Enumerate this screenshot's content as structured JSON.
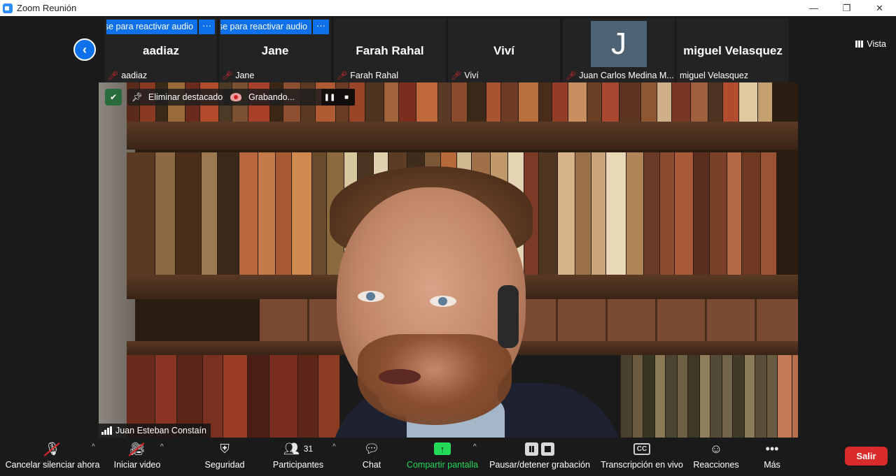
{
  "window": {
    "title": "Zoom Reunión",
    "controls": [
      "—",
      "❐",
      "✕"
    ]
  },
  "view_button": "Vista",
  "gallery": {
    "banner_text": "Pulse para reactivar audio",
    "banner_more": "···",
    "tiles": [
      {
        "display_name": "aadiaz",
        "footer_name": "aadiaz",
        "has_banner": true
      },
      {
        "display_name": "Jane",
        "footer_name": "Jane",
        "has_banner": true
      },
      {
        "display_name": "Farah Rahal",
        "footer_name": "Farah Rahal",
        "has_banner": false
      },
      {
        "display_name": "Viví",
        "footer_name": "Viví",
        "has_banner": false
      },
      {
        "display_name": "",
        "avatar_letter": "J",
        "footer_name": "Juan Carlos Medina M...",
        "has_banner": false
      },
      {
        "display_name": "miguel Velasquez",
        "footer_name": "miguel Velasquez",
        "has_banner": false,
        "muted": false
      }
    ]
  },
  "main_video": {
    "unpin_label": "Eliminar destacado",
    "recording_label": "Grabando...",
    "speaker_name": "Juan Esteban Constaín"
  },
  "toolbar": {
    "mute_label": "Cancelar silenciar ahora",
    "video_label": "Iniciar video",
    "security_label": "Seguridad",
    "participants_label": "Participantes",
    "participants_count": "31",
    "chat_label": "Chat",
    "share_label": "Compartir pantalla",
    "record_label": "Pausar/detener grabación",
    "transcript_label": "Transcripción en vivo",
    "cc_text": "CC",
    "reactions_label": "Reacciones",
    "more_label": "Más",
    "leave_label": "Salir"
  },
  "colors": {
    "accent_blue": "#0e71eb",
    "share_green": "#23d959",
    "leave_red": "#d92b2b",
    "mute_red": "#e02828"
  }
}
